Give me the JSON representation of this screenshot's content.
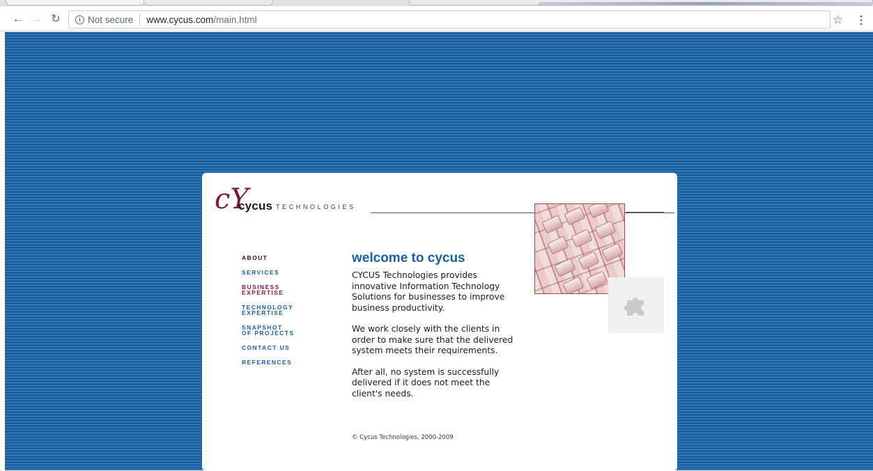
{
  "browser": {
    "security_label": "Not secure",
    "url_host": "www.cycus.com",
    "url_path": "/main.html",
    "icons": [
      "back-arrow-icon",
      "forward-arrow-icon",
      "reload-icon",
      "info-icon",
      "star-icon",
      "menu-icon"
    ]
  },
  "page": {
    "background_color": "#1e66a9",
    "logo": {
      "mark": "cY",
      "word": "cycus",
      "sub": "TECHNOLOGIES",
      "mark_color": "#7a1a34"
    },
    "nav": [
      {
        "line1": "ABOUT",
        "line2": "",
        "state": "active"
      },
      {
        "line1": "SERVICES",
        "line2": "",
        "state": "normal"
      },
      {
        "line1": "BUSINESS",
        "line2": "EXPERTISE",
        "state": "highlight"
      },
      {
        "line1": "TECHNOLOGY",
        "line2": "EXPERTISE",
        "state": "normal"
      },
      {
        "line1": "SNAPSHOT",
        "line2": "OF PROJECTS",
        "state": "normal"
      },
      {
        "line1": "CONTACT US",
        "line2": "",
        "state": "normal"
      },
      {
        "line1": "REFERENCES",
        "line2": "",
        "state": "normal"
      }
    ],
    "nav_colors": {
      "normal": "#1e5c96",
      "active": "#1a1a1a",
      "highlight": "#8a1838"
    },
    "headline": "welcome to cycus",
    "paragraphs": [
      "CYCUS Technologies provides innovative Information Technology Solutions for businesses to improve business productivity.",
      "We work closely with the clients in order to make sure that the delivered system meets their requirements.",
      "After all, no system is successfully delivered if it does not meet the client's needs."
    ],
    "copyright": "© Cycus Technologies, 2000-2009"
  }
}
